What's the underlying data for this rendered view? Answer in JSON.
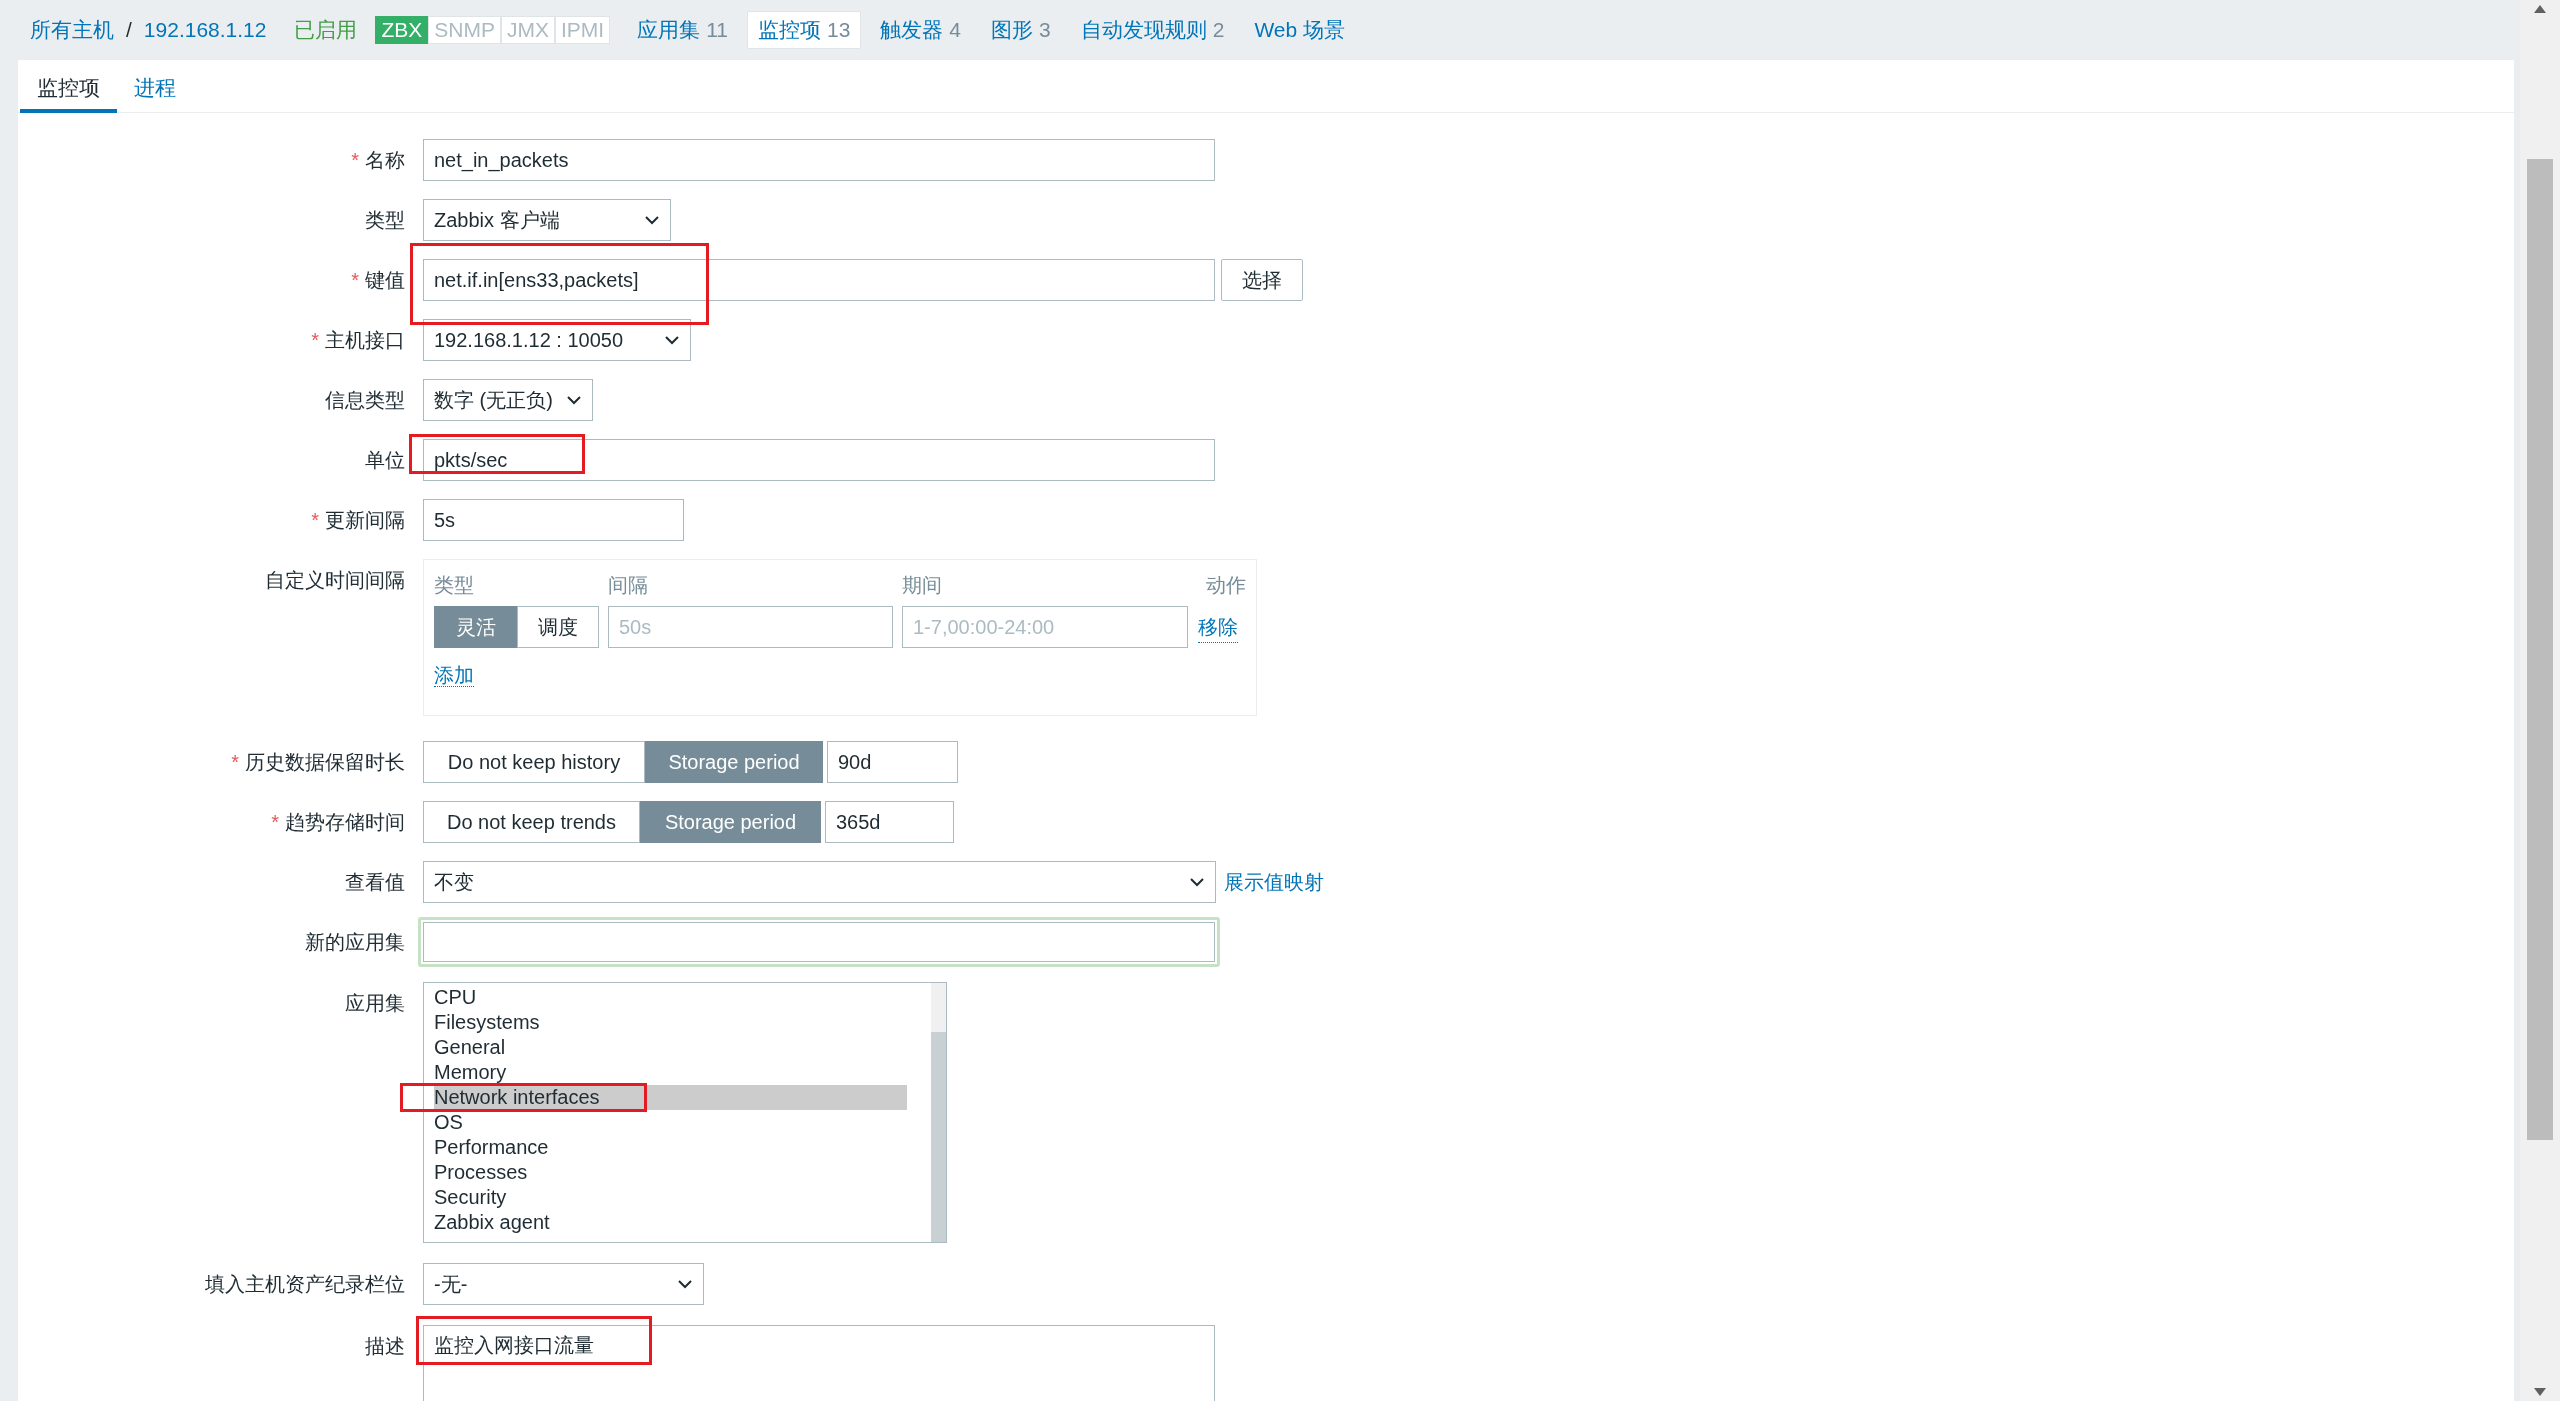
{
  "host_nav": {
    "breadcrumbs": [
      {
        "kind": "link",
        "text": "所有主机"
      },
      {
        "kind": "separator",
        "text": "/"
      },
      {
        "kind": "link",
        "text": "192.168.1.12"
      }
    ],
    "status": "已启用",
    "availability": [
      {
        "label": "ZBX",
        "on": true
      },
      {
        "label": "SNMP",
        "on": false
      },
      {
        "label": "JMX",
        "on": false
      },
      {
        "label": "IPMI",
        "on": false
      }
    ],
    "tabs": [
      {
        "label": "应用集",
        "count": "11",
        "selected": false
      },
      {
        "label": "监控项",
        "count": "13",
        "selected": true
      },
      {
        "label": "触发器",
        "count": "4",
        "selected": false
      },
      {
        "label": "图形",
        "count": "3",
        "selected": false
      },
      {
        "label": "自动发现规则",
        "count": "2",
        "selected": false
      },
      {
        "label": "Web 场景",
        "selected": false
      }
    ]
  },
  "subtabs": [
    {
      "label": "监控项",
      "selected": true
    },
    {
      "label": "进程",
      "selected": false
    }
  ],
  "form": [
    {
      "kind": "text",
      "label": "名称",
      "required_mark": "*",
      "value": "net_in_packets"
    },
    {
      "kind": "select",
      "label": "类型",
      "value": "Zabbix 客户端"
    },
    {
      "kind": "text_button",
      "label": "键值",
      "required_mark": "*",
      "value": "net.if.in[ens33,packets]",
      "button": "选择"
    },
    {
      "kind": "select",
      "label": "主机接口",
      "required_mark": "*",
      "value": "192.168.1.12 : 10050"
    },
    {
      "kind": "select",
      "label": "信息类型",
      "value": "数字 (无正负)"
    },
    {
      "kind": "text",
      "label": "单位",
      "value": "pkts/sec"
    },
    {
      "kind": "short_text",
      "label": "更新间隔",
      "required_mark": "*",
      "value": "5s"
    },
    {
      "kind": "intervals",
      "label": "自定义时间间隔",
      "columns": [
        "类型",
        "间隔",
        "期间",
        "动作"
      ],
      "rows": [
        {
          "type_options": [
            {
              "label": "灵活",
              "selected": true
            },
            {
              "label": "调度",
              "selected": false
            }
          ],
          "interval_placeholder": "50s",
          "period_placeholder": "1-7,00:00-24:00",
          "action": "移除"
        }
      ],
      "add": "添加"
    },
    {
      "kind": "storage",
      "label": "历史数据保留时长",
      "required_mark": "*",
      "options": [
        {
          "label": "Do not keep history",
          "selected": false
        },
        {
          "label": "Storage period",
          "selected": true
        }
      ],
      "value": "90d"
    },
    {
      "kind": "storage",
      "label": "趋势存储时间",
      "required_mark": "*",
      "options": [
        {
          "label": "Do not keep trends",
          "selected": false
        },
        {
          "label": "Storage period",
          "selected": true
        }
      ],
      "value": "365d"
    },
    {
      "kind": "select_link",
      "label": "查看值",
      "value": "不变",
      "link": "展示值映射"
    },
    {
      "kind": "new_app",
      "label": "新的应用集"
    },
    {
      "kind": "listbox",
      "label": "应用集",
      "items": [
        {
          "label": "CPU",
          "selected": false
        },
        {
          "label": "Filesystems",
          "selected": false
        },
        {
          "label": "General",
          "selected": false
        },
        {
          "label": "Memory",
          "selected": false
        },
        {
          "label": "Network interfaces",
          "selected": true
        },
        {
          "label": "OS",
          "selected": false
        },
        {
          "label": "Performance",
          "selected": false
        },
        {
          "label": "Processes",
          "selected": false
        },
        {
          "label": "Security",
          "selected": false
        },
        {
          "label": "Zabbix agent",
          "selected": false
        }
      ]
    },
    {
      "kind": "inventory_select",
      "label": "填入主机资产纪录栏位",
      "value": "-无-"
    },
    {
      "kind": "textarea",
      "label": "描述",
      "value": "监控入网接口流量"
    }
  ]
}
